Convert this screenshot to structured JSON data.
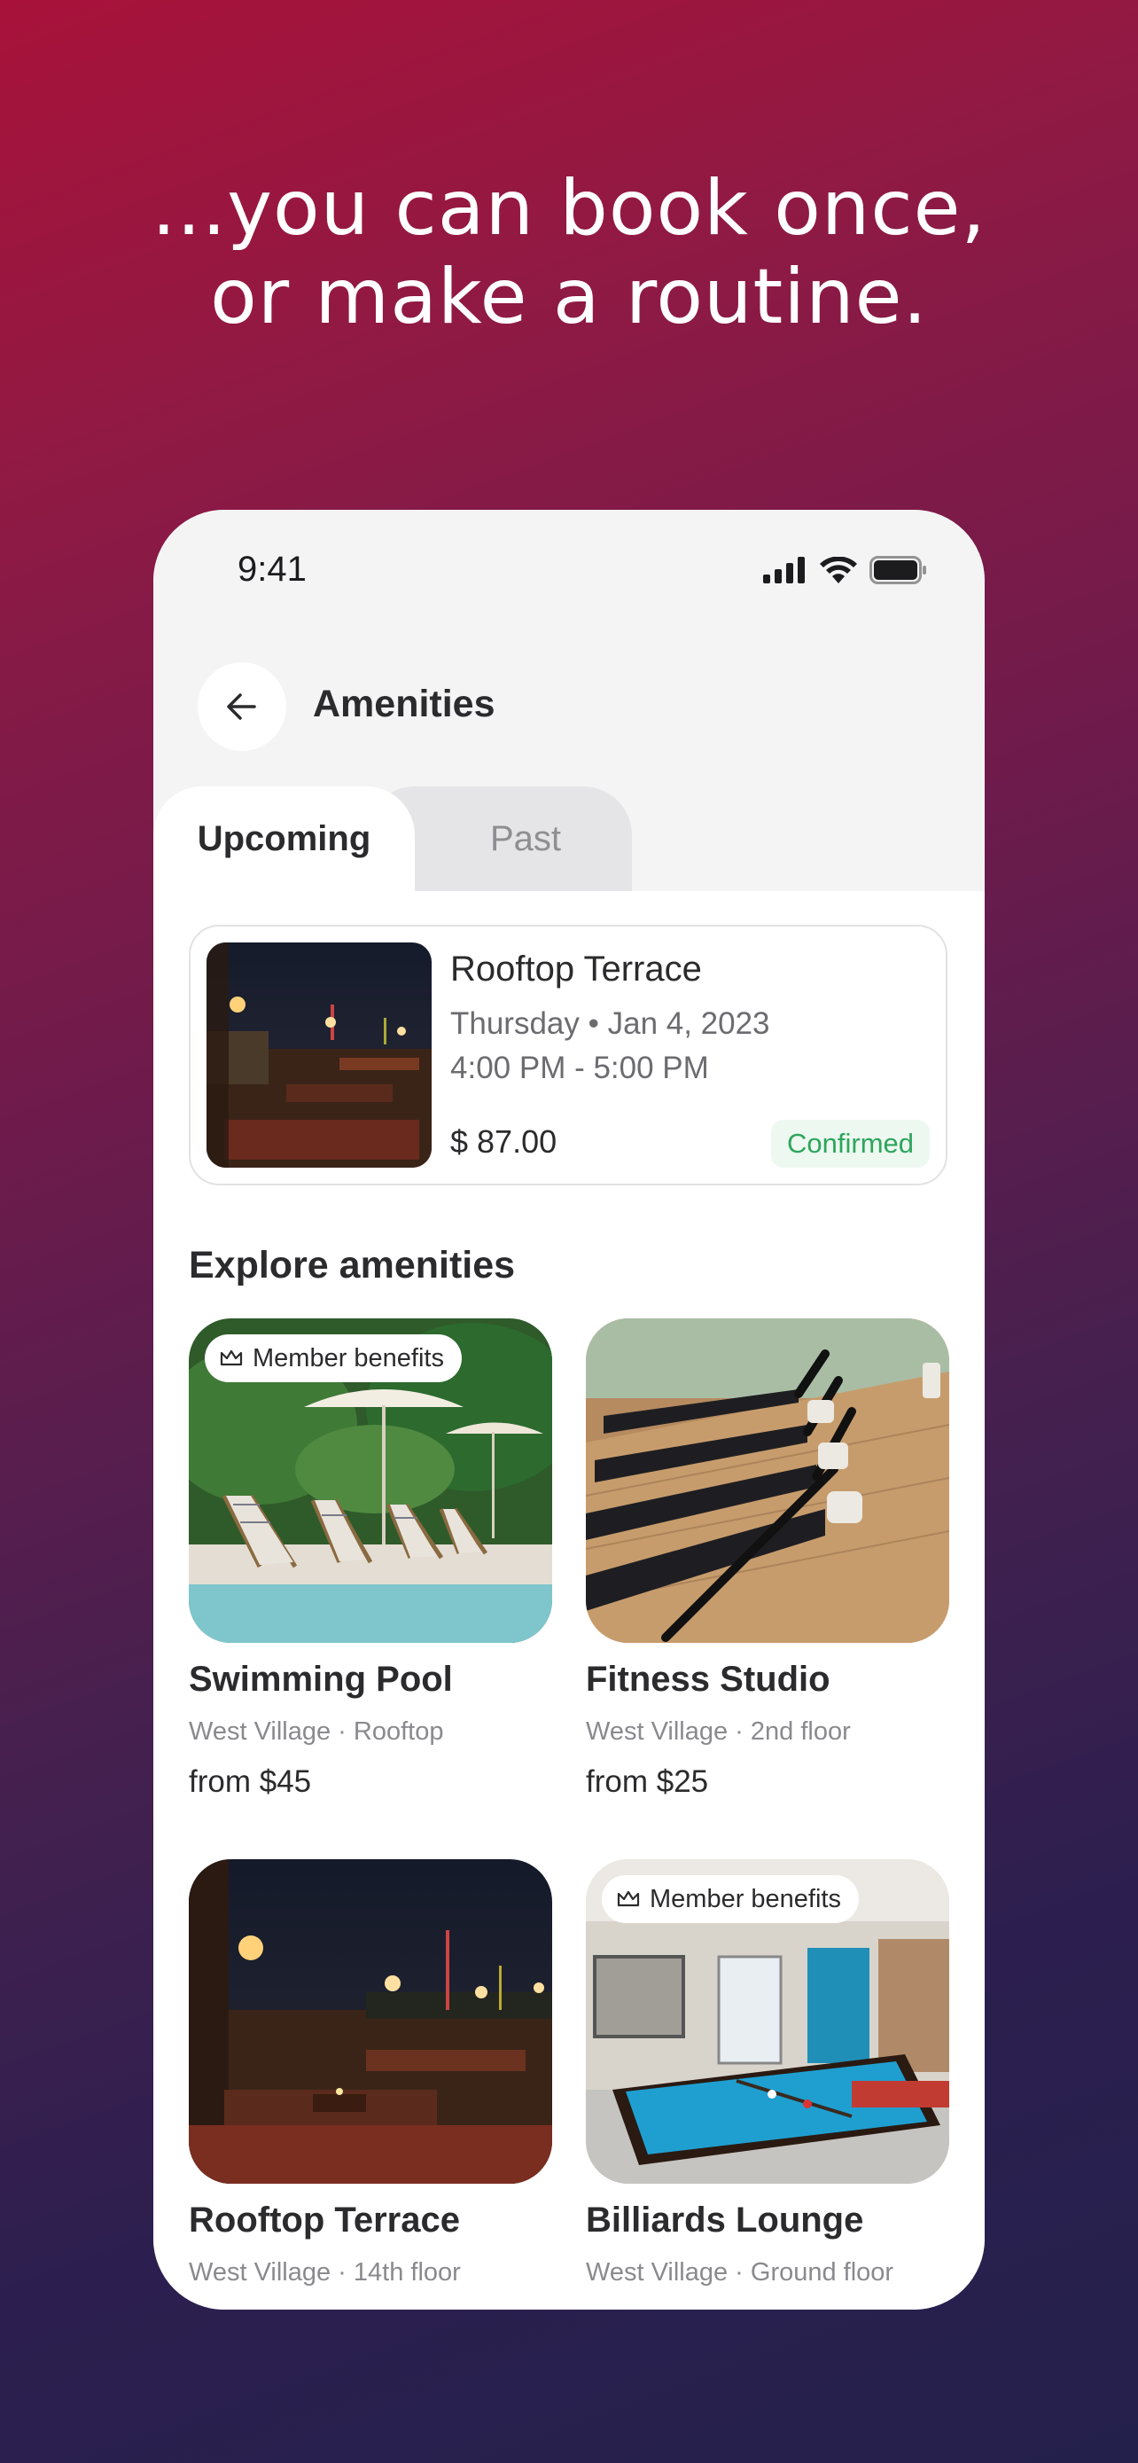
{
  "headline": {
    "line1": "...you can book once,",
    "line2": "or make a routine."
  },
  "status_bar": {
    "time": "9:41",
    "icons": [
      "cellular-signal-icon",
      "wifi-icon",
      "battery-icon"
    ]
  },
  "header": {
    "title": "Amenities",
    "back_icon": "arrow-left-icon"
  },
  "tabs": [
    {
      "label": "Upcoming",
      "selected": true
    },
    {
      "label": "Past",
      "selected": false
    }
  ],
  "booking": {
    "name": "Rooftop Terrace",
    "date": "Thursday • Jan 4, 2023",
    "time": "4:00 PM - 5:00 PM",
    "price": "$ 87.00",
    "status": "Confirmed",
    "status_color": "#2ea55c"
  },
  "explore": {
    "title": "Explore amenities",
    "items": [
      {
        "name": "Swimming Pool",
        "location": "West Village · Rooftop",
        "price": "from $45",
        "badge": "Member benefits"
      },
      {
        "name": "Fitness Studio",
        "location": "West Village · 2nd floor",
        "price": "from $25",
        "badge": ""
      },
      {
        "name": "Rooftop Terrace",
        "location": "West Village · 14th floor",
        "price": "",
        "badge": ""
      },
      {
        "name": "Billiards Lounge",
        "location": "West Village · Ground floor",
        "price": "",
        "badge": "Member benefits"
      }
    ]
  },
  "colors": {
    "background_top": "#a8123a",
    "background_bottom": "#24204c",
    "confirmed_green": "#2ea55c"
  }
}
